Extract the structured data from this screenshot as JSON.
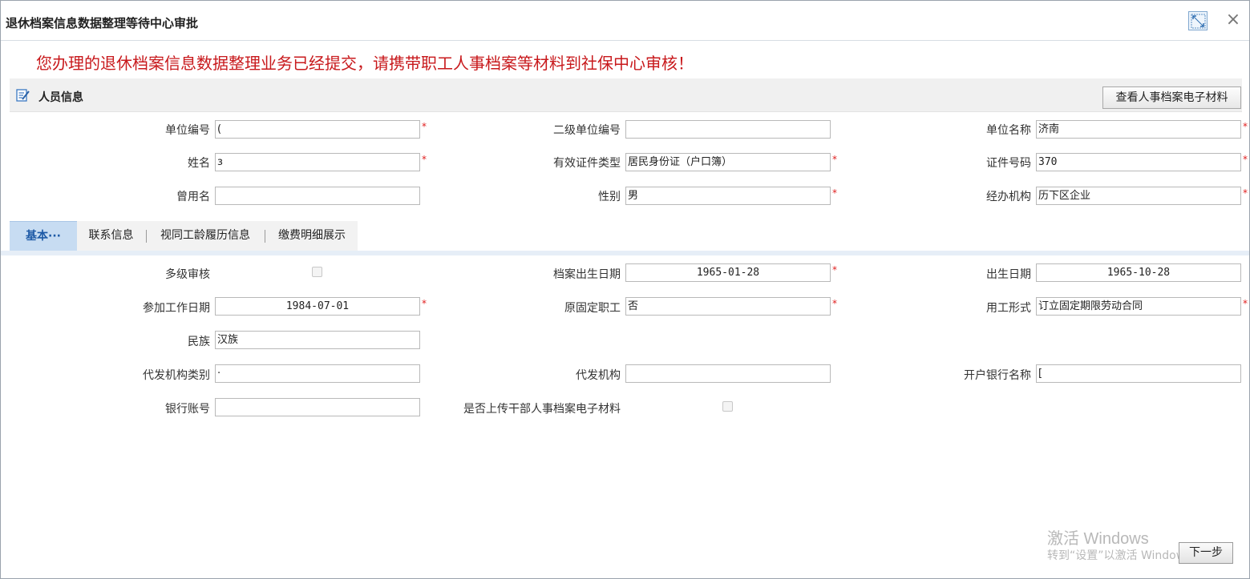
{
  "window": {
    "title": "退休档案信息数据整理等待中心审批"
  },
  "notice": "您办理的退休档案信息数据整理业务已经提交，请携带职工人事档案等材料到社保中心审核！",
  "person_section": {
    "title": "人员信息",
    "view_materials_button": "查看人事档案电子材料",
    "fields": {
      "unit_code": {
        "label": "单位编号",
        "value": "("
      },
      "sub_unit_code": {
        "label": "二级单位编号",
        "value": ""
      },
      "unit_name": {
        "label": "单位名称",
        "value": "济南"
      },
      "name": {
        "label": "姓名",
        "value": "з"
      },
      "id_type": {
        "label": "有效证件类型",
        "value": "居民身份证（户口簿）"
      },
      "id_number": {
        "label": "证件号码",
        "value": "370"
      },
      "former_name": {
        "label": "曾用名",
        "value": ""
      },
      "gender": {
        "label": "性别",
        "value": "男"
      },
      "agency": {
        "label": "经办机构",
        "value": "历下区企业"
      }
    }
  },
  "tabs": [
    {
      "label": "基本···"
    },
    {
      "label": "联系信息"
    },
    {
      "label": "视同工龄履历信息"
    },
    {
      "label": "缴费明细展示"
    }
  ],
  "basic": {
    "multi_level_review": {
      "label": "多级审核",
      "checked": false
    },
    "archive_birth_date": {
      "label": "档案出生日期",
      "value": "1965-01-28"
    },
    "birth_date": {
      "label": "出生日期",
      "value": "1965-10-28"
    },
    "work_start_date": {
      "label": "参加工作日期",
      "value": "1984-07-01"
    },
    "original_fixed_worker": {
      "label": "原固定职工",
      "value": "否"
    },
    "employment_form": {
      "label": "用工形式",
      "value": "订立固定期限劳动合同"
    },
    "ethnicity": {
      "label": "民族",
      "value": "汉族"
    },
    "payout_agency_type": {
      "label": "代发机构类别",
      "value": "·"
    },
    "payout_agency": {
      "label": "代发机构",
      "value": ""
    },
    "bank_name": {
      "label": "开户银行名称",
      "value": "["
    },
    "bank_account": {
      "label": "银行账号",
      "value": ""
    },
    "upload_cadre_materials": {
      "label": "是否上传干部人事档案电子材料",
      "checked": false
    }
  },
  "watermark": {
    "line1": "激活 Windows",
    "line2": "转到“设置”以激活 Windows。"
  },
  "next_button": "下一步",
  "required_mark": "*"
}
